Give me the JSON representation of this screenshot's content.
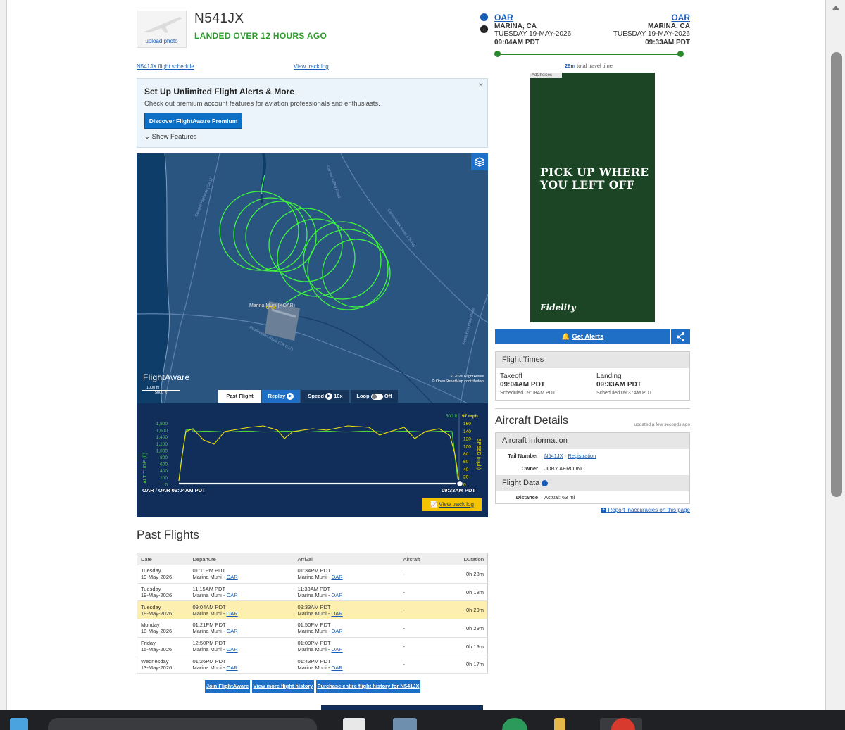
{
  "header": {
    "upload_photo": "upload photo",
    "tail": "N541JX",
    "status": "LANDED OVER 12 HOURS AGO",
    "schedule_link": "N541JX flight schedule",
    "track_link": "View track log"
  },
  "route": {
    "origin": {
      "code": "OAR",
      "city": "MARINA, CA",
      "date": "TUESDAY 19-MAY-2026",
      "time": "09:04AM PDT"
    },
    "destination": {
      "code": "OAR",
      "city": "MARINA, CA",
      "date": "TUESDAY 19-MAY-2026",
      "time": "09:33AM PDT"
    },
    "travel_duration": "29m",
    "travel_label": "total travel time",
    "progress": 1.0
  },
  "alerts_promo": {
    "title": "Set Up Unlimited Flight Alerts & More",
    "text": "Check out premium account features for aviation professionals and enthusiasts.",
    "button": "Discover FlightAware Premium",
    "features": "Show Features",
    "close": "×"
  },
  "map": {
    "airport_label": "Marina Muni (KOAR)",
    "airport_code": "OAR",
    "logo": "FlightAware",
    "scale_m": "1000 m",
    "scale_ft": "5000 ft",
    "copyright_1": "© 2026 FlightAware",
    "copyright_2": "© OpenStreetMap contributors",
    "road_labels": [
      "Coastal Highway (CA 1)",
      "Reservation Road (CR G17)",
      "Carmel Valley Road",
      "Canvasback Road (CA 68)",
      "South Boundary Road"
    ],
    "controls": {
      "past_flight": "Past Flight",
      "replay": "Replay",
      "speed_label": "Speed",
      "speed_value": "10x",
      "loop": "Loop",
      "loop_state": "Off"
    },
    "track_color": "#3ff53f"
  },
  "altitude_chart": {
    "legend_alt": "500 ft",
    "legend_speed": "97 mph",
    "alt_axis_label": "ALTITUDE (ft)",
    "speed_axis_label": "SPEED (mph)",
    "alt_ticks": [
      "1,800",
      "1,600",
      "1,400",
      "1,200",
      "1,000",
      "800",
      "600",
      "400",
      "200",
      "0"
    ],
    "speed_ticks": [
      "160",
      "140",
      "120",
      "100",
      "80",
      "60",
      "40",
      "20",
      "0"
    ],
    "start_label": "OAR / OAR 09:04AM PDT",
    "end_label": "09:33AM PDT",
    "view_track_button": "View track log",
    "alt_color": "#4ed43a",
    "speed_color": "#f2e30b"
  },
  "ad": {
    "choices": "AdChoices",
    "headline_1": "PICK UP WHERE",
    "headline_2": "YOU LEFT OFF",
    "brand": "Fidelity"
  },
  "actions": {
    "get_alerts": "Get Alerts"
  },
  "flight_times": {
    "title": "Flight Times",
    "takeoff_label": "Takeoff",
    "takeoff_time": "09:04AM PDT",
    "takeoff_sched": "Scheduled 09:08AM PDT",
    "landing_label": "Landing",
    "landing_time": "09:33AM PDT",
    "landing_sched": "Scheduled 09:37AM PDT"
  },
  "aircraft_details": {
    "title": "Aircraft Details",
    "updated": "updated a few seconds ago",
    "info_title": "Aircraft Information",
    "tail_label": "Tail Number",
    "tail_value": "N541JX",
    "registration": "Registration",
    "owner_label": "Owner",
    "owner_value": "JOBY AERO INC",
    "data_title": "Flight Data",
    "distance_label": "Distance",
    "distance_value": "Actual: 63 mi",
    "report": "Report inaccuracies on this page"
  },
  "past_flights": {
    "title": "Past Flights",
    "columns": [
      "Date",
      "Departure",
      "Arrival",
      "Aircraft",
      "Duration"
    ],
    "rows": [
      {
        "day": "Tuesday",
        "date": "19-May-2026",
        "dep_time": "01:11PM PDT",
        "dep_place": "Marina Muni",
        "dep_code": "OAR",
        "arr_time": "01:34PM PDT",
        "arr_place": "Marina Muni",
        "arr_code": "OAR",
        "aircraft": "-",
        "duration": "0h 23m",
        "highlight": false
      },
      {
        "day": "Tuesday",
        "date": "19-May-2026",
        "dep_time": "11:15AM PDT",
        "dep_place": "Marina Muni",
        "dep_code": "OAR",
        "arr_time": "11:33AM PDT",
        "arr_place": "Marina Muni",
        "arr_code": "OAR",
        "aircraft": "-",
        "duration": "0h 18m",
        "highlight": false
      },
      {
        "day": "Tuesday",
        "date": "19-May-2026",
        "dep_time": "09:04AM PDT",
        "dep_place": "Marina Muni",
        "dep_code": "OAR",
        "arr_time": "09:33AM PDT",
        "arr_place": "Marina Muni",
        "arr_code": "OAR",
        "aircraft": "-",
        "duration": "0h 29m",
        "highlight": true
      },
      {
        "day": "Monday",
        "date": "18-May-2026",
        "dep_time": "01:21PM PDT",
        "dep_place": "Marina Muni",
        "dep_code": "OAR",
        "arr_time": "01:50PM PDT",
        "arr_place": "Marina Muni",
        "arr_code": "OAR",
        "aircraft": "-",
        "duration": "0h 29m",
        "highlight": false
      },
      {
        "day": "Friday",
        "date": "15-May-2026",
        "dep_time": "12:50PM PDT",
        "dep_place": "Marina Muni",
        "dep_code": "OAR",
        "arr_time": "01:09PM PDT",
        "arr_place": "Marina Muni",
        "arr_code": "OAR",
        "aircraft": "-",
        "duration": "0h 19m",
        "highlight": false
      },
      {
        "day": "Wednesday",
        "date": "13-May-2026",
        "dep_time": "01:26PM PDT",
        "dep_place": "Marina Muni",
        "dep_code": "OAR",
        "arr_time": "01:43PM PDT",
        "arr_place": "Marina Muni",
        "arr_code": "OAR",
        "aircraft": "-",
        "duration": "0h 17m",
        "highlight": false
      }
    ]
  },
  "footer_buttons": {
    "join": "Join FlightAware",
    "more_history": "View more flight history",
    "purchase": "Purchase entire flight history for N541JX"
  }
}
